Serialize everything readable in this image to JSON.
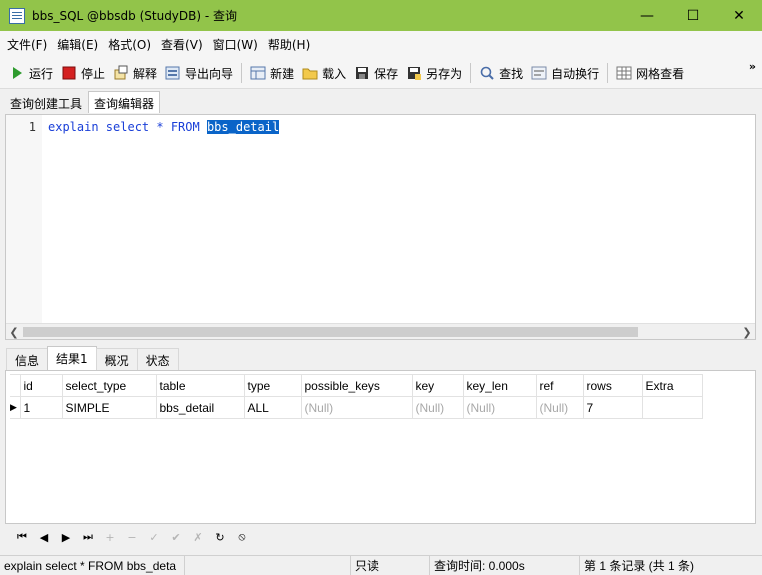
{
  "window": {
    "title": "bbs_SQL @bbsdb (StudyDB) - 查询"
  },
  "menu": [
    "文件(F)",
    "编辑(E)",
    "格式(O)",
    "查看(V)",
    "窗口(W)",
    "帮助(H)"
  ],
  "toolbar": {
    "run": "运行",
    "stop": "停止",
    "explain": "解释",
    "export": "导出向导",
    "new": "新建",
    "load": "载入",
    "save": "保存",
    "saveas": "另存为",
    "find": "查找",
    "wrap": "自动换行",
    "grid": "网格查看"
  },
  "subtabs": [
    "查询创建工具",
    "查询编辑器"
  ],
  "editor": {
    "line_number": "1",
    "code_prefix": "explain select * FROM ",
    "code_selected": "bbs_detail"
  },
  "result_tabs": [
    "信息",
    "结果1",
    "概况",
    "状态"
  ],
  "result": {
    "columns": [
      "id",
      "select_type",
      "table",
      "type",
      "possible_keys",
      "key",
      "key_len",
      "ref",
      "rows",
      "Extra"
    ],
    "row": [
      "1",
      "SIMPLE",
      "bbs_detail",
      "ALL",
      "(Null)",
      "(Null)",
      "(Null)",
      "(Null)",
      "7",
      ""
    ]
  },
  "status": {
    "sql": "explain select * FROM bbs_deta",
    "mode": "只读",
    "time": "查询时间: 0.000s",
    "records": "第 1 条记录 (共 1 条)"
  },
  "colors": {
    "titlebar": "#92c44a",
    "selection": "#0a64c8",
    "keyword": "#1a3fd8"
  }
}
